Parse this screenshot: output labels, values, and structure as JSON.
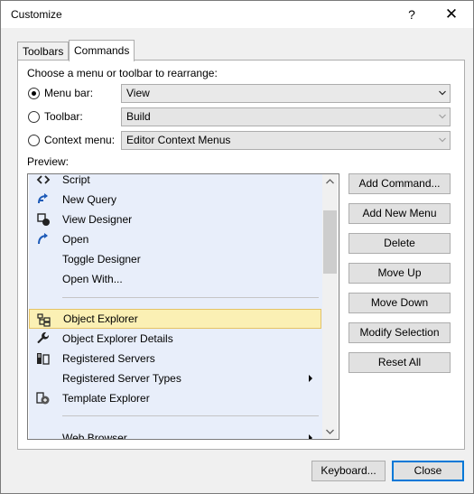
{
  "window": {
    "title": "Customize",
    "help_glyph": "?",
    "close_glyph": "✕"
  },
  "tabs": [
    {
      "label": "Toolbars",
      "active": false
    },
    {
      "label": "Commands",
      "active": true
    }
  ],
  "commands": {
    "heading": "Choose a menu or toolbar to rearrange:",
    "options": [
      {
        "label": "Menu bar:",
        "checked": true,
        "value": "View",
        "enabled": true
      },
      {
        "label": "Toolbar:",
        "checked": false,
        "value": "Build",
        "enabled": false
      },
      {
        "label": "Context menu:",
        "checked": false,
        "value": "Editor Context Menus",
        "enabled": false
      }
    ],
    "preview_label": "Preview:",
    "preview_items": [
      {
        "label": "Script",
        "icon": "script-icon"
      },
      {
        "label": "New Query",
        "icon": "new-query-icon"
      },
      {
        "label": "View Designer",
        "icon": "view-designer-icon"
      },
      {
        "label": "Open",
        "icon": "open-icon"
      },
      {
        "label": "Toggle Designer",
        "icon": ""
      },
      {
        "label": "Open With...",
        "icon": ""
      },
      {
        "label": "Object Explorer",
        "icon": "object-explorer-icon",
        "highlighted": true
      },
      {
        "label": "Object Explorer Details",
        "icon": "wrench-icon"
      },
      {
        "label": "Registered Servers",
        "icon": "registered-servers-icon"
      },
      {
        "label": "Registered Server Types",
        "icon": "",
        "submenu": true
      },
      {
        "label": "Template Explorer",
        "icon": "template-explorer-icon"
      },
      {
        "label": "Web Browser",
        "icon": "",
        "submenu": true
      }
    ],
    "buttons": {
      "add_command": "Add Command...",
      "add_new_menu": "Add New Menu",
      "delete": "Delete",
      "move_up": "Move Up",
      "move_down": "Move Down",
      "modify_selection": "Modify Selection",
      "reset_all": "Reset All"
    }
  },
  "footer": {
    "keyboard": "Keyboard...",
    "close": "Close"
  },
  "colors": {
    "accent": "#0078d7",
    "highlight": "#fbf0b4",
    "list_bg": "#e8eefa",
    "icon_blue": "#1e5bb8"
  }
}
